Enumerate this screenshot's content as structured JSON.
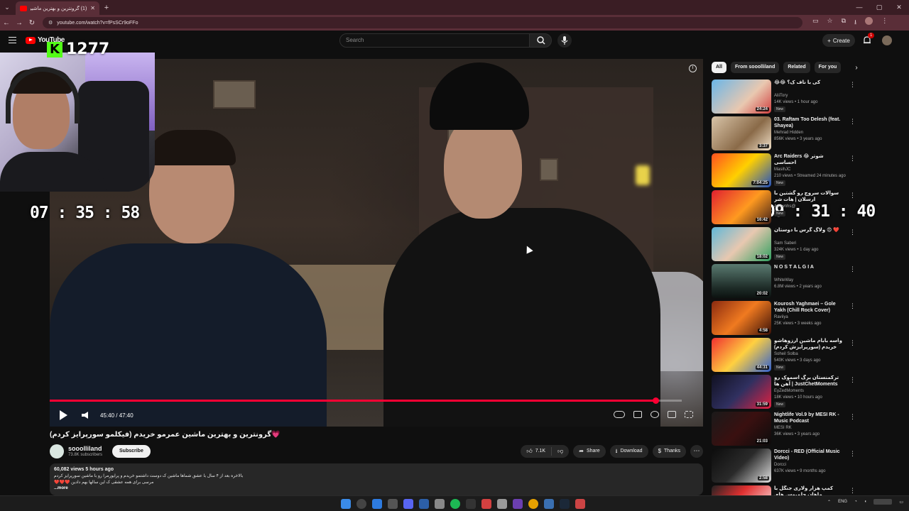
{
  "browser": {
    "tab_title": "(1) گرونترین و بهترین ماشین",
    "url": "youtube.com/watch?v=fPsSCr9oFFo"
  },
  "header": {
    "logo_text": "YouTube",
    "search_placeholder": "Search",
    "create_label": "Create",
    "notification_count": "1"
  },
  "overlay": {
    "kick_logo": "K",
    "kick_viewers": "1277",
    "timer_left": "07 : 35 : 58",
    "timer_right": "09 : 31 : 40"
  },
  "player": {
    "time": "45:40 / 47:40",
    "progress": 0.958
  },
  "video": {
    "title": "💗گرونترین و بهترین ماشین عمرمو خریدم (فیکلمو سورپرایز کردم)",
    "channel": "sooolliland",
    "subscribers": "73.8K subscribers",
    "subscribe_label": "Subscribe",
    "likes": "7.1K",
    "share_label": "Share",
    "download_label": "Download",
    "thanks_label": "Thanks",
    "stats": "60,082 views  5 hours ago",
    "desc_line1": "بالاخره بعد از ۴ سال با عشق شماها ماشین ک دوست داشتمو خریدم و پرایورمرا رو با ماشین سورپرایز کردم",
    "desc_line2": "مرسی برای همه عشقی ک این سالها بهم دادین ❤️❤️❤️",
    "desc_more": "...more"
  },
  "sidebar": {
    "chips": [
      "All",
      "From sooolliland",
      "Related",
      "For you"
    ],
    "recs": [
      {
        "title": "😂😂 کی با ناف ک؟",
        "channel": "AliiTory",
        "meta": "14K views • 1 hour ago",
        "new": "New",
        "duration": "24:24"
      },
      {
        "title": "03. Raftam Too Delesh (feat. Shayea)",
        "channel": "Mehrad Hidden",
        "meta": "856K views • 3 years ago",
        "new": "",
        "duration": "3:37"
      },
      {
        "title": "Arc Raiders 😂 شوتر احساسی",
        "channel": "MasihJC",
        "meta": "210 views • Streamed 24 minutes ago",
        "new": "New",
        "duration": "7:04:25"
      },
      {
        "title": "سوالات سروچ رو گشتین با ارسلان | هات شر",
        "channel": "Arslwnhs@",
        "meta": "",
        "new": "New",
        "duration": "16:42"
      },
      {
        "title": "ولاگ گرس با دوستان 😍 ❤️",
        "channel": "Sam Saberi",
        "meta": "324K views • 1 day ago",
        "new": "New",
        "duration": "18:02"
      },
      {
        "title": "N O S T A L G I A",
        "channel": "WhiteWay",
        "meta": "6.8M views • 2 years ago",
        "new": "",
        "duration": "20:02"
      },
      {
        "title": "Kourosh Yaghmaei – Gole Yakh (Chill Rock Cover)",
        "channel": "Raviiya",
        "meta": "25K views • 3 weeks ago",
        "new": "",
        "duration": "4:58"
      },
      {
        "title": "واسه بابام ماشین آرزوهاشو خریدم (سورپرایزش کردم)",
        "channel": "Soheil Solba",
        "meta": "540K views • 3 days ago",
        "new": "New",
        "duration": "44:31"
      },
      {
        "title": "ترکمنستان برگ اسموک رو آهن ها | JustChetMoments #313",
        "channel": "EyZedMoments",
        "meta": "18K views • 10 hours ago",
        "new": "New",
        "duration": "31:59"
      },
      {
        "title": "Nightlife Vol.9 by MESI RK - Music Podcast",
        "channel": "MESI RK",
        "meta": "36K views • 3 years ago",
        "new": "",
        "duration": "21:03"
      },
      {
        "title": "Dorcci - RED (Official Music Video)",
        "channel": "Dorcci",
        "meta": "637K views • 9 months ago",
        "new": "",
        "duration": "2:58"
      },
      {
        "title": "کمپ هزار ولاری جنگل با ماهان چلمپوس های",
        "channel": "",
        "meta": "",
        "new": "",
        "duration": ""
      }
    ]
  },
  "taskbar": {
    "lang": "ENG"
  },
  "colors": {
    "accent": "#ff0033",
    "kick_green": "#53fc18",
    "browser_frame": "#5a2e38"
  }
}
